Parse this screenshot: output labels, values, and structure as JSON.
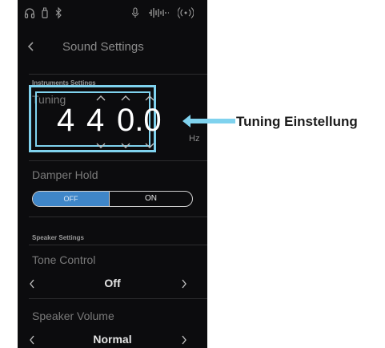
{
  "header": {
    "title": "Sound Settings"
  },
  "instrument_settings": {
    "section_label": "Instruments Settings",
    "tuning": {
      "label": "Tuning",
      "digits": [
        "4",
        "4",
        "0.0"
      ],
      "unit": "Hz"
    },
    "damper_hold": {
      "label": "Damper Hold",
      "off_label": "OFF",
      "on_label": "ON",
      "selected": "OFF"
    }
  },
  "speaker_settings": {
    "section_label": "Speaker Settings",
    "tone_control": {
      "label": "Tone Control",
      "value": "Off"
    },
    "speaker_volume": {
      "label": "Speaker Volume",
      "value": "Normal"
    }
  },
  "callout": {
    "label": "Tuning Einstellung"
  },
  "colors": {
    "accent_blue": "#3f86c8",
    "callout_cyan": "#7fd2ee",
    "screen_bg": "#0c0c0e"
  },
  "icons": [
    "headphones-icon",
    "usb-icon",
    "bluetooth-icon",
    "microphone-icon",
    "audio-wave-icon",
    "wireless-icon",
    "chevron-left-icon",
    "chevron-right-icon",
    "chevron-up-icon",
    "chevron-down-icon",
    "callout-arrow-icon"
  ]
}
